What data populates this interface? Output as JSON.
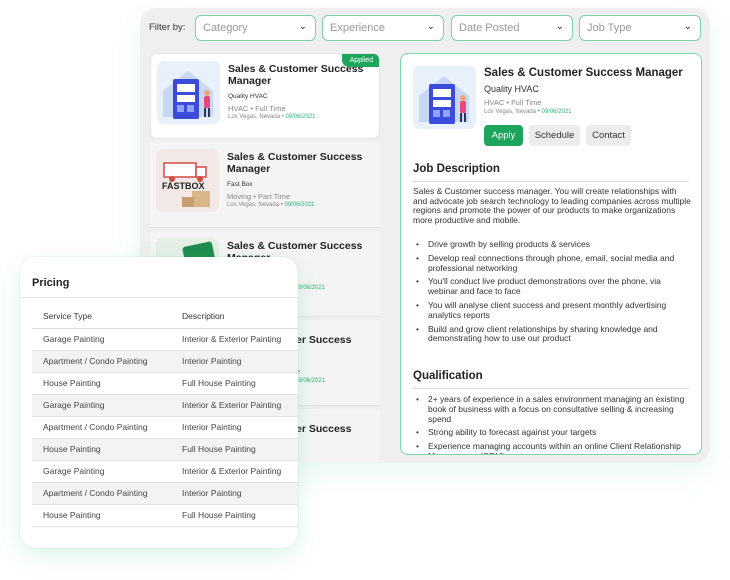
{
  "filters": {
    "label": "Filter by:",
    "selects": [
      {
        "value": "Category"
      },
      {
        "value": "Experience"
      },
      {
        "value": "Date Posted"
      },
      {
        "value": "Job Type"
      }
    ]
  },
  "jobs": [
    {
      "title": "Sales & Customer Success Manager",
      "company": "Quality HVAC",
      "category": "HVAC",
      "type": "Full Time",
      "location": "Los Vegas, Nevada",
      "date": "09/06/2021",
      "badge": "Applied",
      "icon": "hvac-unit-illustration"
    },
    {
      "title": "Sales & Customer Success Manager",
      "company": "Fast Box",
      "category": "Moving",
      "type": "Part Time",
      "location": "Los Vegas, Nevada",
      "date": "09/06/2021",
      "icon": "fastbox-moving-logo"
    },
    {
      "title": "Sales & Customer Success Manager",
      "date": "09/06/2021",
      "icon": "green-box-illustration"
    },
    {
      "title_fragment": "er Success",
      "meta_fragment": "e",
      "date": "09/06/2021"
    },
    {
      "title_fragment": "er Success"
    }
  ],
  "detail": {
    "title": "Sales & Customer Success Manager",
    "company": "Quality HVAC",
    "category": "HVAC",
    "type": "Full Time",
    "location": "Los Vegas, Nevada",
    "date": "09/06/2021",
    "buttons": {
      "apply": "Apply",
      "schedule": "Schedule",
      "contact": "Contact"
    },
    "job_description_heading": "Job Description",
    "description": "Sales & Customer success manager. You will create relationships with and advocate job search technology to leading companies across multiple regions and promote the power of our products to make organizations more productive and mobile.",
    "responsibilities": [
      "Drive growth by selling products & services",
      "Develop real connections through phone, email, social media and professional networking",
      "You'll conduct live product demonstrations over the phone, via webinar and face to face",
      "You will analyse client success and present monthly advertising analytics reports",
      "Build and grow client relationships by sharing knowledge and demonstrating how to use our product"
    ],
    "qualification_heading": "Qualification",
    "qualifications": [
      "2+ years of experience in a sales environment managing an existing book of business with a focus on consultative selling & increasing spend",
      "Strong ability to forecast against your targets",
      "Experience managing accounts within an online Client Relationship Management (CRM) system"
    ]
  },
  "pricing": {
    "title": "Pricing",
    "headers": [
      "Service Type",
      "Description"
    ],
    "rows": [
      [
        "Garage Painting",
        "Interior & Exterior Painting"
      ],
      [
        "Apartment / Condo Painting",
        "Interior Painting"
      ],
      [
        "House Painting",
        "Full House Painting"
      ],
      [
        "Garage Painting",
        "Interior & Exterior Painting"
      ],
      [
        "Apartment / Condo Painting",
        "Interior Painting"
      ],
      [
        "House Painting",
        "Full House Painting"
      ],
      [
        "Garage Painting",
        "Interior & Exterior Painting"
      ],
      [
        "Apartment / Condo Painting",
        "Interior Painting"
      ],
      [
        "House Painting",
        "Full House Painting"
      ]
    ]
  },
  "colors": {
    "accent": "#1ea55d",
    "accent_light": "#2bb673",
    "border": "#7ad8a8"
  }
}
